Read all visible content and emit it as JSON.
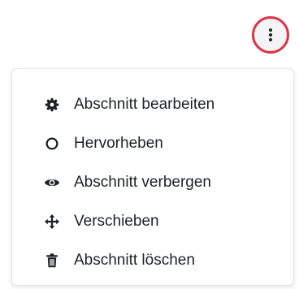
{
  "more_button": {
    "icon": "kebab-vertical-icon",
    "accent_color": "#dc3545"
  },
  "menu": {
    "items": [
      {
        "label": "Abschnitt bearbeiten",
        "icon": "gear-icon"
      },
      {
        "label": "Hervorheben",
        "icon": "circle-outline-icon"
      },
      {
        "label": "Abschnitt verbergen",
        "icon": "eye-icon"
      },
      {
        "label": "Verschieben",
        "icon": "move-arrows-icon"
      },
      {
        "label": "Abschnitt löschen",
        "icon": "trash-icon"
      }
    ]
  }
}
